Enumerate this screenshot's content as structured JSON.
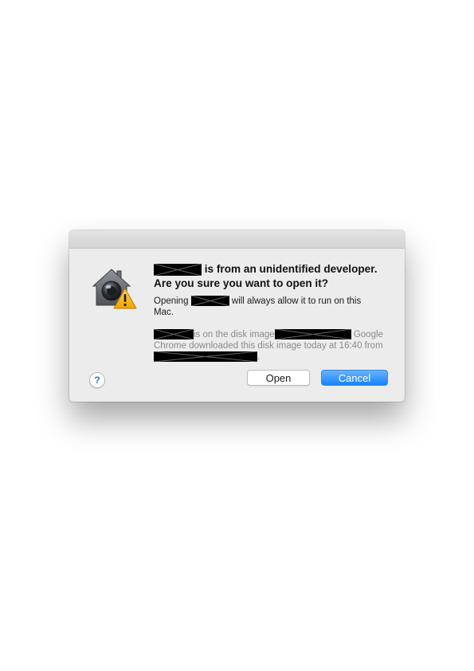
{
  "dialog": {
    "headline_line1": "is from an unidentified developer.",
    "headline_line2": "Are you sure you want to open it?",
    "message_prefix": "Opening",
    "message_suffix": "will always allow it to run on this Mac.",
    "detail_part1": "is on the disk image",
    "detail_part2": "Google Chrome downloaded this disk image today at 16:40 from",
    "detail_end": "."
  },
  "icons": {
    "alert": "gatekeeper-warning-icon",
    "help": "question-mark-icon"
  },
  "buttons": {
    "help_label": "?",
    "open_label": "Open",
    "cancel_label": "Cancel"
  },
  "colors": {
    "accent": "#1683fb",
    "dialog_bg": "#ececec",
    "redaction": "#000000"
  }
}
